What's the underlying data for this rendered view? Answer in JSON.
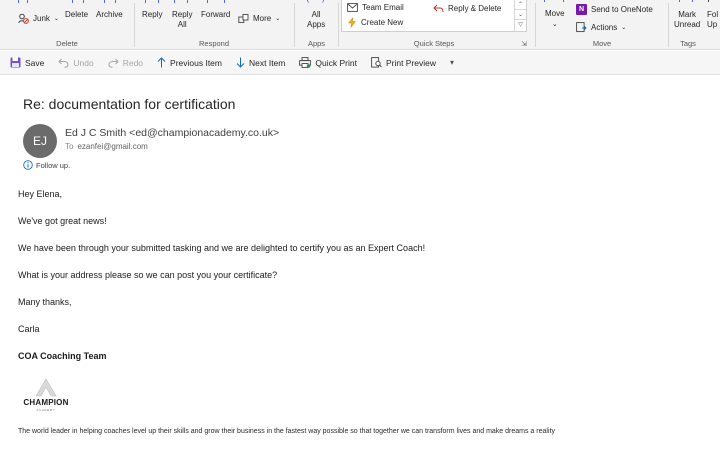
{
  "ribbon": {
    "delete_group": {
      "junk": "Junk",
      "delete": "Delete",
      "archive": "Archive",
      "label": "Delete"
    },
    "respond_group": {
      "reply": "Reply",
      "reply_all_1": "Reply",
      "reply_all_2": "All",
      "forward": "Forward",
      "more": "More",
      "label": "Respond"
    },
    "apps_group": {
      "all_1": "All",
      "all_2": "Apps",
      "label": "Apps"
    },
    "quick_steps": {
      "items": [
        "Team Email",
        "Create New",
        "Reply & Delete"
      ],
      "label": "Quick Steps"
    },
    "move_group": {
      "move": "Move",
      "send_onenote": "Send to OneNote",
      "actions": "Actions",
      "label": "Move"
    },
    "tags_group": {
      "mark_1": "Mark",
      "mark_2": "Unread",
      "follow_1": "Fol",
      "follow_2": "Up",
      "label": "Tags"
    }
  },
  "toolbar": {
    "save": "Save",
    "undo": "Undo",
    "redo": "Redo",
    "previous": "Previous Item",
    "next": "Next Item",
    "quick_print": "Quick Print",
    "print_preview": "Print Preview"
  },
  "message": {
    "subject": "Re: documentation for certification",
    "avatar_initials": "EJ",
    "sender": "Ed J C Smith <ed@championacademy.co.uk>",
    "to_label": "To",
    "to": "ezanfei@gmail.com",
    "follow_up": "Follow up.",
    "body": [
      "Hey Elena,",
      "We've got great news!",
      "We have been through your submitted tasking and we are delighted to certify you as an Expert Coach!",
      "What is your address please so we can post you your certificate?",
      "Many thanks,",
      "Carla",
      "COA Coaching Team"
    ],
    "logo_text": "CHAMPION",
    "logo_sub": "ACADEMY",
    "tagline": "The world leader in helping coaches level up their skills and grow their business in the fastest way possible so that together we can transform lives and make dreams a reality"
  },
  "colors": {
    "accent": "#4f6bed",
    "onenote": "#7719aa",
    "avatar": "#6b6b6b",
    "info": "#0f6cbd"
  }
}
